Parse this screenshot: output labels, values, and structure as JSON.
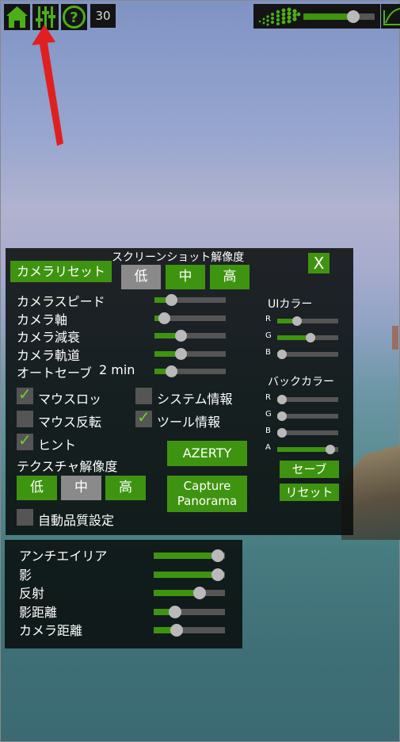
{
  "toolbar": {
    "fps": "30",
    "home_icon": "home-icon",
    "settings_icon": "sliders-icon",
    "help_icon": "help-icon",
    "quality_slider": 0.7
  },
  "settings": {
    "screenshot_res_title": "スクリーンショット解像度",
    "camera_reset": "カメラリセット",
    "close": "X",
    "screenshot_res": [
      {
        "label": "低",
        "selected": true
      },
      {
        "label": "中",
        "selected": false
      },
      {
        "label": "高",
        "selected": false
      }
    ],
    "sliders": [
      {
        "label": "カメラスピード",
        "value": 0.24
      },
      {
        "label": "カメラ軸",
        "value": 0.14
      },
      {
        "label": "カメラ減衰",
        "value": 0.37
      },
      {
        "label": "カメラ軌道",
        "value": 0.37
      },
      {
        "label": "オートセーブ",
        "suffix": "2 min",
        "value": 0.24
      }
    ],
    "checkboxes": [
      {
        "label": "マウスロッ",
        "checked": true
      },
      {
        "label": "システム情報",
        "checked": false
      },
      {
        "label": "マウス反転",
        "checked": false
      },
      {
        "label": "ツール情報",
        "checked": true
      },
      {
        "label": "ヒント",
        "checked": true
      },
      {
        "label": "自動品質設定",
        "checked": false
      }
    ],
    "azerty": "AZERTY",
    "capture_panorama_1": "Capture",
    "capture_panorama_2": "Panorama",
    "texture_res_title": "テクスチャ解像度",
    "texture_res": [
      {
        "label": "低",
        "selected": false
      },
      {
        "label": "中",
        "selected": true
      },
      {
        "label": "高",
        "selected": false
      }
    ],
    "ui_color": {
      "title": "UIカラー",
      "channels": [
        {
          "label": "R",
          "value": 0.32
        },
        {
          "label": "G",
          "value": 0.54
        },
        {
          "label": "B",
          "value": 0.08
        }
      ]
    },
    "back_color": {
      "title": "バックカラー",
      "channels": [
        {
          "label": "R",
          "value": 0.08
        },
        {
          "label": "G",
          "value": 0.08
        },
        {
          "label": "B",
          "value": 0.08
        },
        {
          "label": "A",
          "value": 0.87
        }
      ]
    },
    "save": "セーブ",
    "reset": "リセット"
  },
  "graphics": {
    "sliders": [
      {
        "label": "アンチエイリア",
        "value": 0.9
      },
      {
        "label": "影",
        "value": 0.9
      },
      {
        "label": "反射",
        "value": 0.64
      },
      {
        "label": "影距離",
        "value": 0.3
      },
      {
        "label": "カメラ距離",
        "value": 0.32
      }
    ]
  },
  "colors": {
    "accent": "#3e9410",
    "selected": "#8a8a8a",
    "panel": "#080c0a",
    "arrow": "#e02020"
  }
}
